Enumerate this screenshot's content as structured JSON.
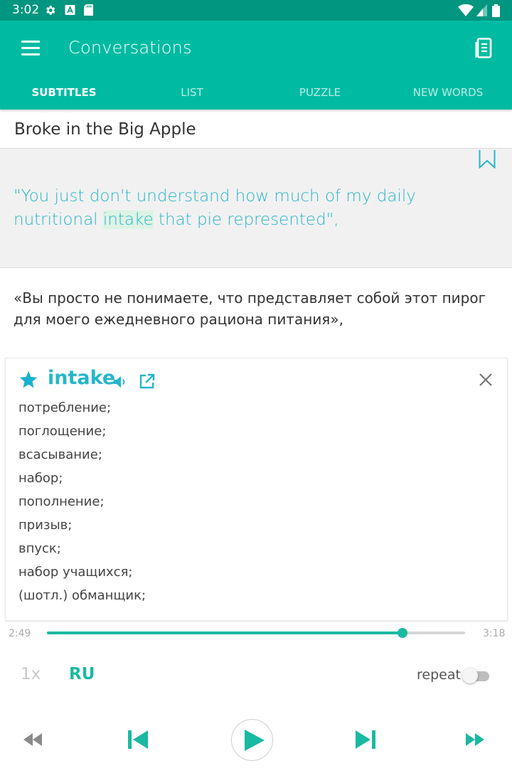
{
  "status_bar": {
    "time": "3:02"
  },
  "app_bar": {
    "title": "Conversations",
    "tabs": [
      {
        "label": "SUBTITLES",
        "active": true
      },
      {
        "label": "LIST",
        "active": false
      },
      {
        "label": "PUZZLE",
        "active": false
      },
      {
        "label": "NEW WORDS",
        "active": false
      }
    ]
  },
  "lesson": {
    "title": "Broke in the Big Apple"
  },
  "subtitle": {
    "before": "\"You just don't understand how much of my daily nutritional ",
    "highlight": "intake",
    "after": " that pie represented\","
  },
  "translation": "«Вы просто не понимаете, что представляет собой этот пирог для моего ежедневного рациона питания»,",
  "dictionary": {
    "word": "intake",
    "starred": true,
    "meanings": [
      "потребление;",
      "поглощение;",
      "всасывание;",
      "набор;",
      "пополнение;",
      "призыв;",
      "впуск;",
      "набор учащихся;",
      "(шотл.) обманщик;"
    ]
  },
  "player": {
    "current_time": "2:49",
    "total_time": "3:18",
    "progress": 0.85,
    "speed": "1x",
    "language": "RU",
    "repeat_label": "repeat",
    "repeat_on": false
  },
  "colors": {
    "status_bar": "#00967f",
    "app_bar": "#00bba2",
    "accent": "#1ab9a1",
    "subtitle_text": "#26b6c9"
  }
}
